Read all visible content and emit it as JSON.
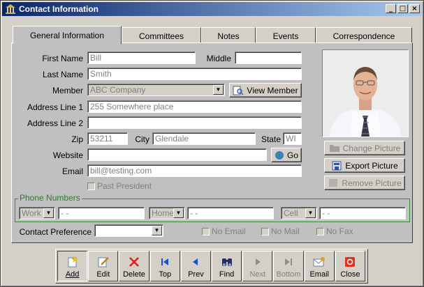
{
  "window": {
    "title": "Contact Information",
    "controls": [
      "_",
      "□",
      "×"
    ]
  },
  "tabs": [
    "General Information",
    "Committees",
    "Notes",
    "Events",
    "Correspondence"
  ],
  "form": {
    "first_name_label": "First Name",
    "first_name": "Bill",
    "middle_label": "Middle",
    "middle": "",
    "last_name_label": "Last Name",
    "last_name": "Smith",
    "member_label": "Member",
    "member": "ABC Company",
    "view_member_label": "View Member",
    "address1_label": "Address Line 1",
    "address1": "255 Somewhere place",
    "address2_label": "Address Line 2",
    "address2": "",
    "zip_label": "Zip",
    "zip": "53211",
    "city_label": "City",
    "city": "Glendale",
    "state_label": "State",
    "state": "WI",
    "website_label": "Website",
    "website": "",
    "go_label": "Go",
    "email_label": "Email",
    "email": "bill@testing.com",
    "past_president_label": "Past President"
  },
  "photo_buttons": {
    "change": "Change Picture",
    "export": "Export Picture",
    "remove": "Remove Picture"
  },
  "phone": {
    "group_title": "Phone Numbers",
    "entries": [
      {
        "type": "Work",
        "number": "-  -"
      },
      {
        "type": "Home",
        "number": "-  -"
      },
      {
        "type": "Cell",
        "number": "-  -"
      }
    ]
  },
  "contact_pref": {
    "label": "Contact Preference",
    "value": ""
  },
  "opt_outs": {
    "no_email": "No Email",
    "no_mail": "No Mail",
    "no_fax": "No Fax"
  },
  "toolbar": [
    {
      "label": "Add",
      "icon": "add-icon",
      "state": "pressed"
    },
    {
      "label": "Edit",
      "icon": "edit-icon",
      "state": "normal"
    },
    {
      "label": "Delete",
      "icon": "delete-icon",
      "state": "normal"
    },
    {
      "label": "Top",
      "icon": "first-record-icon",
      "state": "normal"
    },
    {
      "label": "Prev",
      "icon": "prev-icon",
      "state": "normal"
    },
    {
      "label": "Find",
      "icon": "binoculars-icon",
      "state": "normal"
    },
    {
      "label": "Next",
      "icon": "next-icon",
      "state": "disabled"
    },
    {
      "label": "Bottom",
      "icon": "last-record-icon",
      "state": "disabled"
    },
    {
      "label": "Email",
      "icon": "email-icon",
      "state": "normal"
    },
    {
      "label": "Close",
      "icon": "close-icon",
      "state": "normal"
    }
  ]
}
